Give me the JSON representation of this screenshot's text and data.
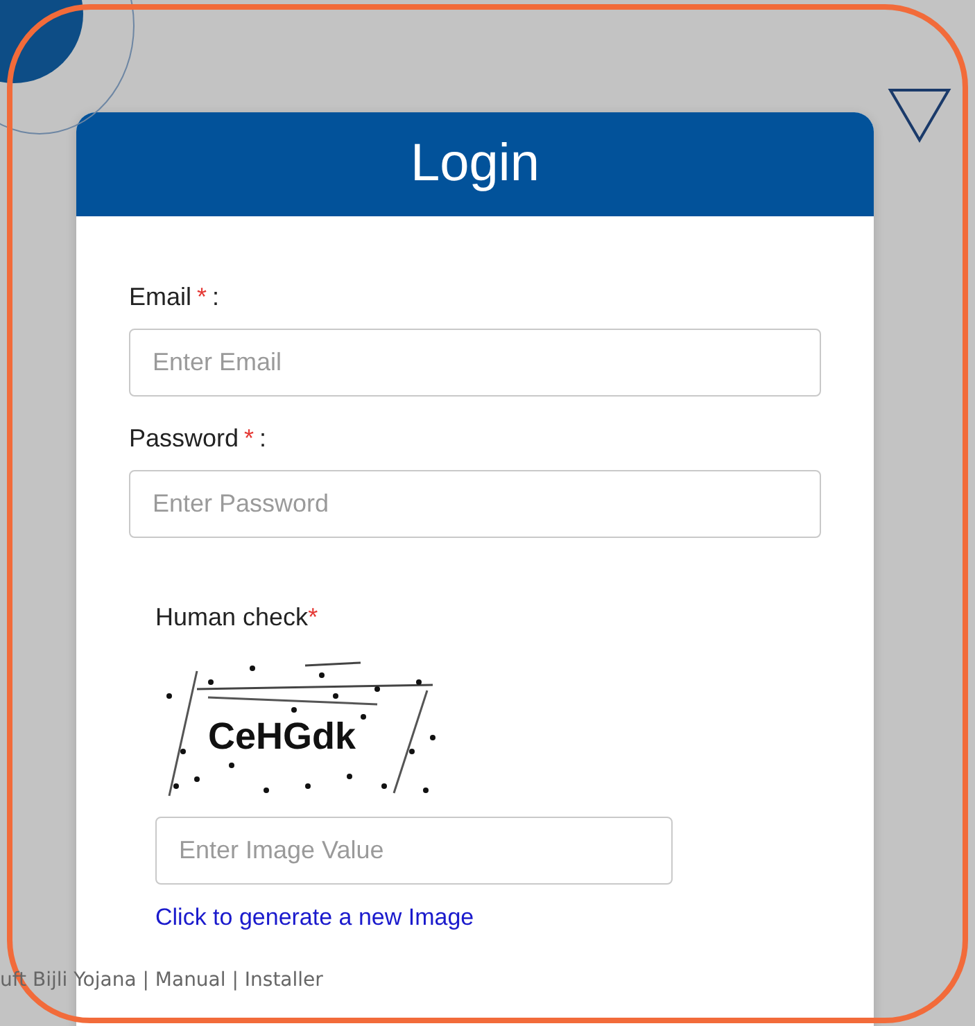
{
  "login": {
    "title": "Login",
    "fields": [
      {
        "label": "Email",
        "required_mark": "*",
        "colon": ":",
        "placeholder": "Enter Email"
      },
      {
        "label": "Password",
        "required_mark": "*",
        "colon": ":",
        "placeholder": "Enter Password"
      }
    ],
    "captcha": {
      "label": "Human check",
      "required_mark": "*",
      "code": "CeHGdk",
      "placeholder": "Enter Image Value",
      "refresh_link": "Click to generate a new Image"
    }
  },
  "footer": "uft Bijli Yojana | Manual | Installer"
}
